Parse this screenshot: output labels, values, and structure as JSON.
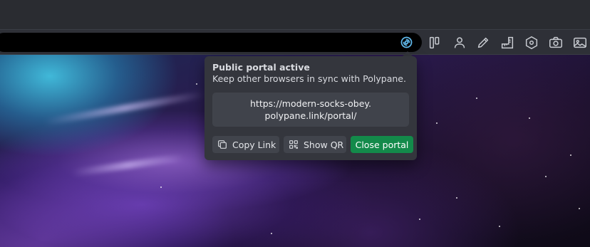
{
  "toolbar": {
    "icons": [
      "portal-icon",
      "panel-layout-icon",
      "user-icon",
      "pencil-icon",
      "rulers-icon",
      "hexagon-icon",
      "camera-icon",
      "image-icon"
    ]
  },
  "popover": {
    "title": "Public portal active",
    "subtitle": "Keep other browsers in sync with Polypane.",
    "link": "https://modern-socks-obey.polypane.link/portal/",
    "buttons": {
      "copy_link": "Copy Link",
      "show_qr": "Show QR",
      "close_portal": "Close portal"
    }
  },
  "colors": {
    "accent_portal": "#5fb6e8",
    "close_button": "#138a4a",
    "popover_bg": "#34363d"
  }
}
